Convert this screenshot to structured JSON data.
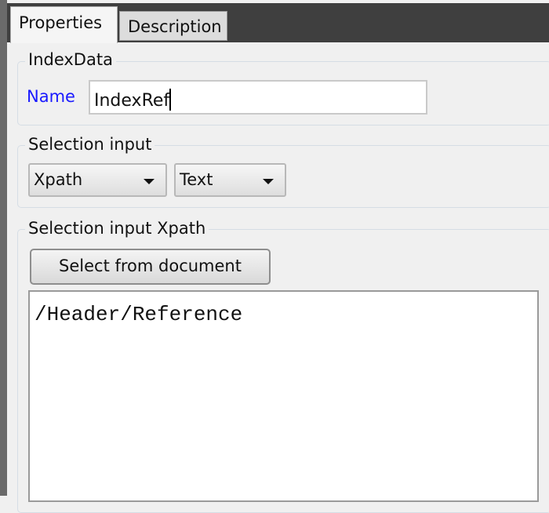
{
  "tabs": [
    {
      "label": "Properties",
      "active": true
    },
    {
      "label": "Description",
      "active": false
    }
  ],
  "index_data": {
    "title": "IndexData",
    "name_label": "Name",
    "name_value": "IndexRef"
  },
  "selection_input": {
    "title": "Selection input",
    "type_value": "Xpath",
    "format_value": "Text"
  },
  "selection_xpath": {
    "title": "Selection input Xpath",
    "select_button": "Select from document",
    "xpath_value": "/Header/Reference"
  },
  "colors": {
    "name_label": "#1a1aff",
    "tab_bar": "#3f3f3f"
  }
}
